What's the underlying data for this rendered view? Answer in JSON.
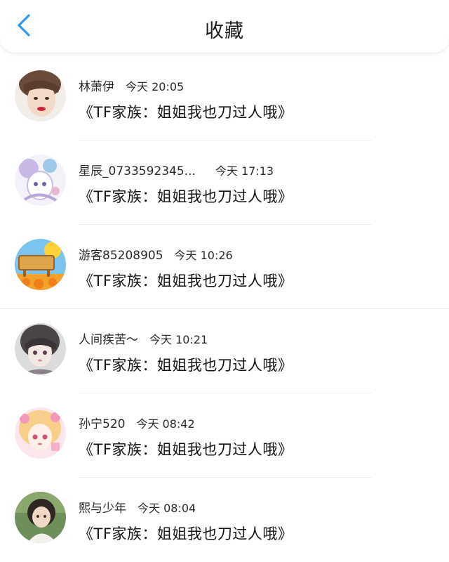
{
  "header": {
    "title": "收藏",
    "back_icon": "chevron-left-icon",
    "accent_color": "#2c9af1"
  },
  "items": [
    {
      "name": "林萧伊",
      "time": "今天 20:05",
      "text": "《TF家族：姐姐我也刀过人哦》",
      "avatar_icon": "avatar-photo-icon"
    },
    {
      "name": "星辰_0733592345...",
      "time": "今天 17:13",
      "text": "《TF家族：姐姐我也刀过人哦》",
      "avatar_icon": "avatar-anime-icon"
    },
    {
      "name": "游客85208905",
      "time": "今天 10:26",
      "text": "《TF家族：姐姐我也刀过人哦》",
      "avatar_icon": "avatar-farm-icon"
    },
    {
      "name": "人间疾苦～",
      "time": "今天 10:21",
      "text": "《TF家族：姐姐我也刀过人哦》",
      "avatar_icon": "avatar-anime-icon"
    },
    {
      "name": "孙宁520",
      "time": "今天 08:42",
      "text": "《TF家族：姐姐我也刀过人哦》",
      "avatar_icon": "avatar-anime-icon"
    },
    {
      "name": "熙与少年",
      "time": "今天 08:04",
      "text": "《TF家族：姐姐我也刀过人哦》",
      "avatar_icon": "avatar-photo-icon"
    }
  ]
}
